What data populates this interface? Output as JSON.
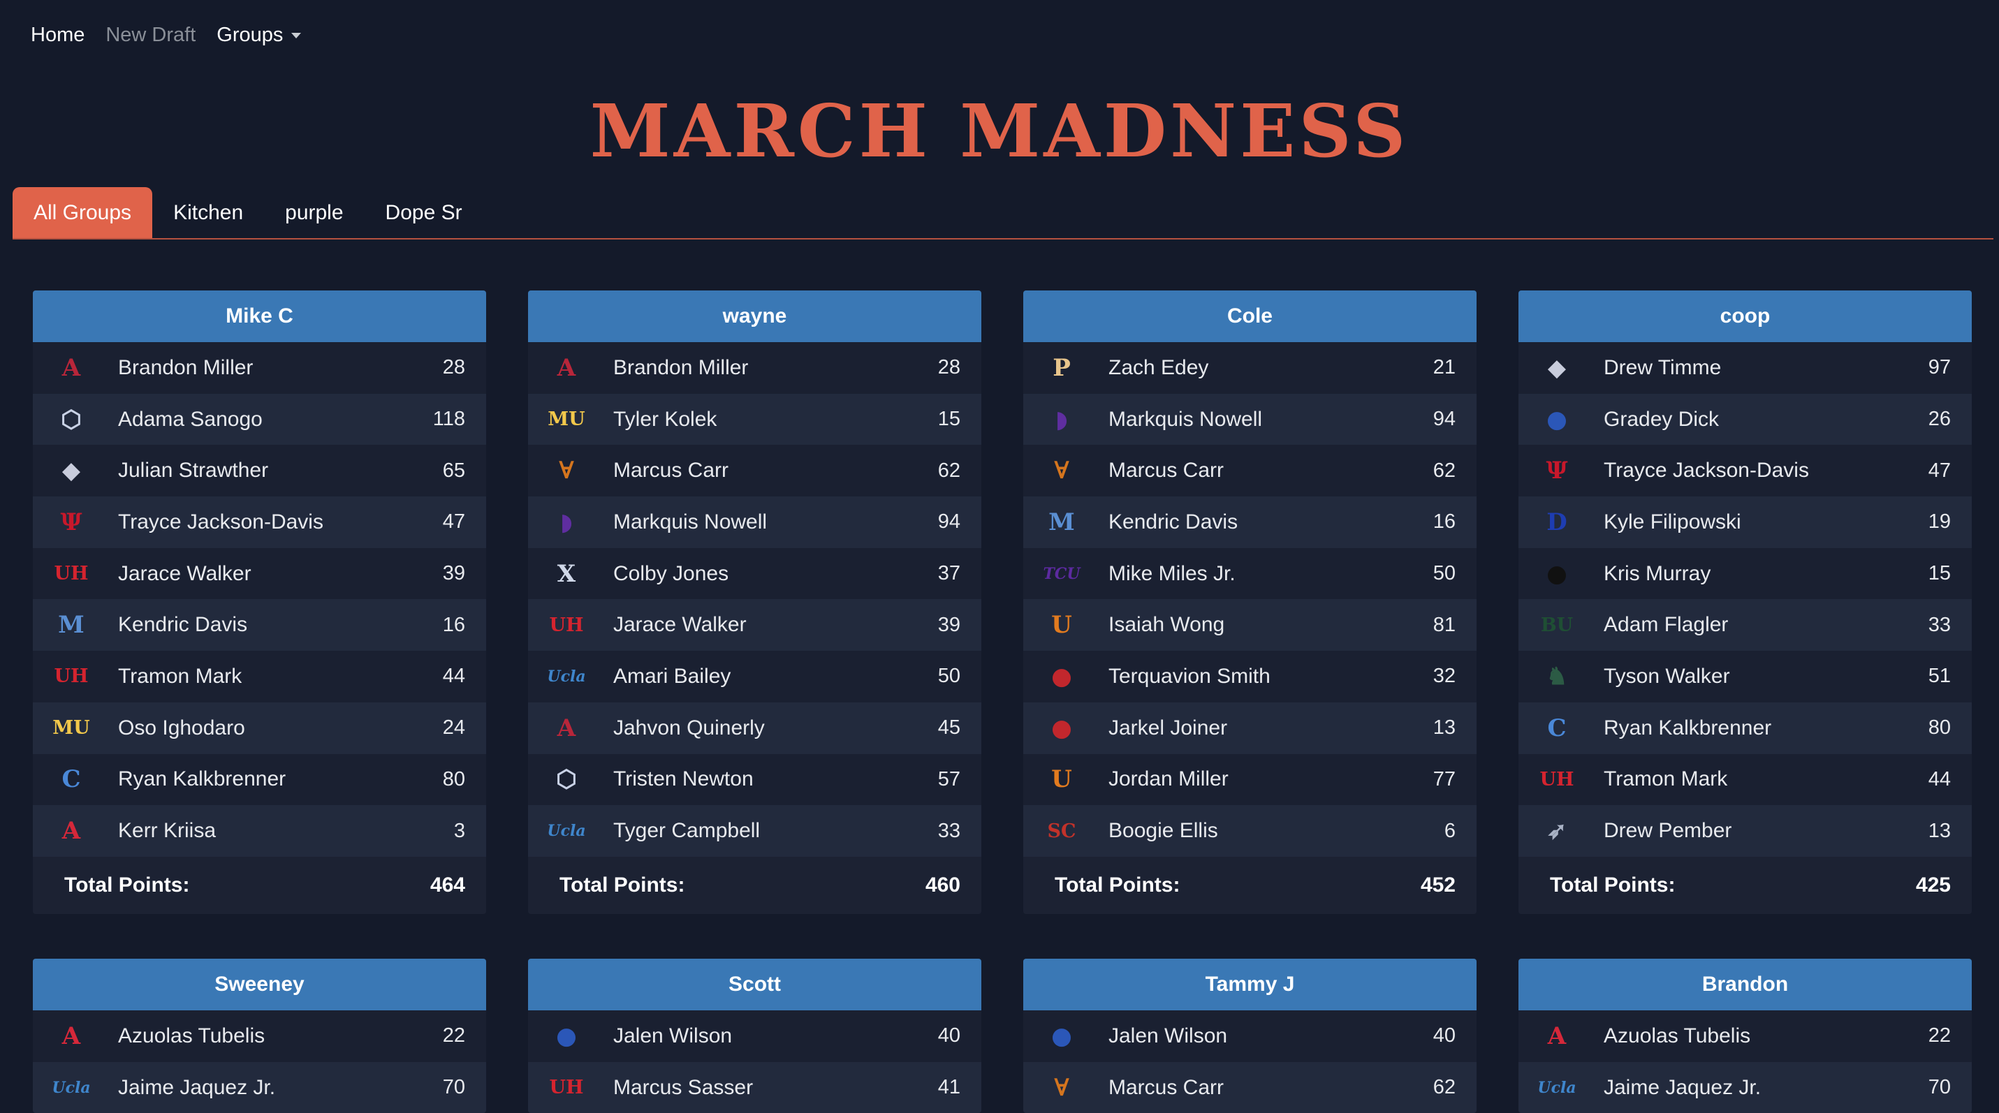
{
  "nav": {
    "home": "Home",
    "new_draft": "New Draft",
    "groups": "Groups"
  },
  "title": "MARCH MADNESS",
  "tabs": [
    "All Groups",
    "Kitchen",
    "purple",
    "Dope Sr"
  ],
  "total_label": "Total Points:",
  "teams": {
    "alabama": {
      "glyph": "A",
      "color": "#b8263a",
      "icon": "alabama-icon"
    },
    "uconn": {
      "glyph": "⬡",
      "color": "#c9d2e6",
      "icon": "uconn-husky-icon"
    },
    "gonzaga": {
      "glyph": "◆",
      "color": "#c8ccdc",
      "icon": "gonzaga-bulldog-icon"
    },
    "indiana": {
      "glyph": "Ψ",
      "color": "#c8182b",
      "icon": "indiana-icon"
    },
    "houston": {
      "glyph": "UH",
      "color": "#d5242f",
      "icon": "houston-icon"
    },
    "memphis": {
      "glyph": "M",
      "color": "#5a8fd3",
      "icon": "memphis-icon"
    },
    "marquette": {
      "glyph": "MU",
      "color": "#f2c84b",
      "icon": "marquette-icon"
    },
    "creighton": {
      "glyph": "C",
      "color": "#4a88d8",
      "icon": "creighton-icon"
    },
    "arizona": {
      "glyph": "A",
      "color": "#d5283a",
      "icon": "arizona-icon"
    },
    "purdue": {
      "glyph": "P",
      "color": "#e8c58c",
      "icon": "purdue-icon"
    },
    "kstate": {
      "glyph": "◗",
      "color": "#5f2ea0",
      "icon": "kansas-state-icon"
    },
    "texas": {
      "glyph": "∀",
      "color": "#d5751e",
      "icon": "texas-longhorn-icon"
    },
    "xavier": {
      "glyph": "X",
      "color": "#cfd7e8",
      "icon": "xavier-icon"
    },
    "ucla": {
      "glyph": "Ucla",
      "color": "#3f86cc",
      "icon": "ucla-icon"
    },
    "tcu": {
      "glyph": "TCU",
      "color": "#5c2aa0",
      "icon": "tcu-icon"
    },
    "miami": {
      "glyph": "U",
      "color": "#e27b1f",
      "icon": "miami-icon"
    },
    "ncstate": {
      "glyph": "●",
      "color": "#c2272d",
      "icon": "nc-state-wolf-icon"
    },
    "usc": {
      "glyph": "SC",
      "color": "#c2322a",
      "icon": "usc-icon"
    },
    "kansas": {
      "glyph": "●",
      "color": "#2b57b8",
      "icon": "kansas-jayhawk-icon"
    },
    "duke": {
      "glyph": "D",
      "color": "#1e3db2",
      "icon": "duke-icon"
    },
    "iowa": {
      "glyph": "●",
      "color": "#111111",
      "icon": "iowa-hawkeye-icon"
    },
    "baylor": {
      "glyph": "BU",
      "color": "#1f4f34",
      "icon": "baylor-icon"
    },
    "michiganstate": {
      "glyph": "♞",
      "color": "#2c5b45",
      "icon": "michigan-state-spartan-icon"
    },
    "utahstate": {
      "glyph": "➶",
      "color": "#aab3c6",
      "icon": "utah-state-icon"
    }
  },
  "cards": [
    {
      "name": "Mike C",
      "total": "464",
      "players": [
        {
          "team": "alabama",
          "name": "Brandon Miller",
          "points": "28"
        },
        {
          "team": "uconn",
          "name": "Adama Sanogo",
          "points": "118"
        },
        {
          "team": "gonzaga",
          "name": "Julian Strawther",
          "points": "65"
        },
        {
          "team": "indiana",
          "name": "Trayce Jackson-Davis",
          "points": "47"
        },
        {
          "team": "houston",
          "name": "Jarace Walker",
          "points": "39"
        },
        {
          "team": "memphis",
          "name": "Kendric Davis",
          "points": "16"
        },
        {
          "team": "houston",
          "name": "Tramon Mark",
          "points": "44"
        },
        {
          "team": "marquette",
          "name": "Oso Ighodaro",
          "points": "24"
        },
        {
          "team": "creighton",
          "name": "Ryan Kalkbrenner",
          "points": "80"
        },
        {
          "team": "arizona",
          "name": "Kerr Kriisa",
          "points": "3"
        }
      ]
    },
    {
      "name": "wayne",
      "total": "460",
      "players": [
        {
          "team": "alabama",
          "name": "Brandon Miller",
          "points": "28"
        },
        {
          "team": "marquette",
          "name": "Tyler Kolek",
          "points": "15"
        },
        {
          "team": "texas",
          "name": "Marcus Carr",
          "points": "62"
        },
        {
          "team": "kstate",
          "name": "Markquis Nowell",
          "points": "94"
        },
        {
          "team": "xavier",
          "name": "Colby Jones",
          "points": "37"
        },
        {
          "team": "houston",
          "name": "Jarace Walker",
          "points": "39"
        },
        {
          "team": "ucla",
          "name": "Amari Bailey",
          "points": "50"
        },
        {
          "team": "alabama",
          "name": "Jahvon Quinerly",
          "points": "45"
        },
        {
          "team": "uconn",
          "name": "Tristen Newton",
          "points": "57"
        },
        {
          "team": "ucla",
          "name": "Tyger Campbell",
          "points": "33"
        }
      ]
    },
    {
      "name": "Cole",
      "total": "452",
      "players": [
        {
          "team": "purdue",
          "name": "Zach Edey",
          "points": "21"
        },
        {
          "team": "kstate",
          "name": "Markquis Nowell",
          "points": "94"
        },
        {
          "team": "texas",
          "name": "Marcus Carr",
          "points": "62"
        },
        {
          "team": "memphis",
          "name": "Kendric Davis",
          "points": "16"
        },
        {
          "team": "tcu",
          "name": "Mike Miles Jr.",
          "points": "50"
        },
        {
          "team": "miami",
          "name": "Isaiah Wong",
          "points": "81"
        },
        {
          "team": "ncstate",
          "name": "Terquavion Smith",
          "points": "32"
        },
        {
          "team": "ncstate",
          "name": "Jarkel Joiner",
          "points": "13"
        },
        {
          "team": "miami",
          "name": "Jordan Miller",
          "points": "77"
        },
        {
          "team": "usc",
          "name": "Boogie Ellis",
          "points": "6"
        }
      ]
    },
    {
      "name": "coop",
      "total": "425",
      "players": [
        {
          "team": "gonzaga",
          "name": "Drew Timme",
          "points": "97"
        },
        {
          "team": "kansas",
          "name": "Gradey Dick",
          "points": "26"
        },
        {
          "team": "indiana",
          "name": "Trayce Jackson-Davis",
          "points": "47"
        },
        {
          "team": "duke",
          "name": "Kyle Filipowski",
          "points": "19"
        },
        {
          "team": "iowa",
          "name": "Kris Murray",
          "points": "15"
        },
        {
          "team": "baylor",
          "name": "Adam Flagler",
          "points": "33"
        },
        {
          "team": "michiganstate",
          "name": "Tyson Walker",
          "points": "51"
        },
        {
          "team": "creighton",
          "name": "Ryan Kalkbrenner",
          "points": "80"
        },
        {
          "team": "houston",
          "name": "Tramon Mark",
          "points": "44"
        },
        {
          "team": "utahstate",
          "name": "Drew Pember",
          "points": "13"
        }
      ]
    },
    {
      "name": "Sweeney",
      "total": "",
      "players": [
        {
          "team": "arizona",
          "name": "Azuolas Tubelis",
          "points": "22"
        },
        {
          "team": "ucla",
          "name": "Jaime Jaquez Jr.",
          "points": "70"
        }
      ]
    },
    {
      "name": "Scott",
      "total": "",
      "players": [
        {
          "team": "kansas",
          "name": "Jalen Wilson",
          "points": "40"
        },
        {
          "team": "houston",
          "name": "Marcus Sasser",
          "points": "41"
        }
      ]
    },
    {
      "name": "Tammy J",
      "total": "",
      "players": [
        {
          "team": "kansas",
          "name": "Jalen Wilson",
          "points": "40"
        },
        {
          "team": "texas",
          "name": "Marcus Carr",
          "points": "62"
        }
      ]
    },
    {
      "name": "Brandon",
      "total": "",
      "players": [
        {
          "team": "arizona",
          "name": "Azuolas Tubelis",
          "points": "22"
        },
        {
          "team": "ucla",
          "name": "Jaime Jaquez Jr.",
          "points": "70"
        }
      ]
    }
  ]
}
